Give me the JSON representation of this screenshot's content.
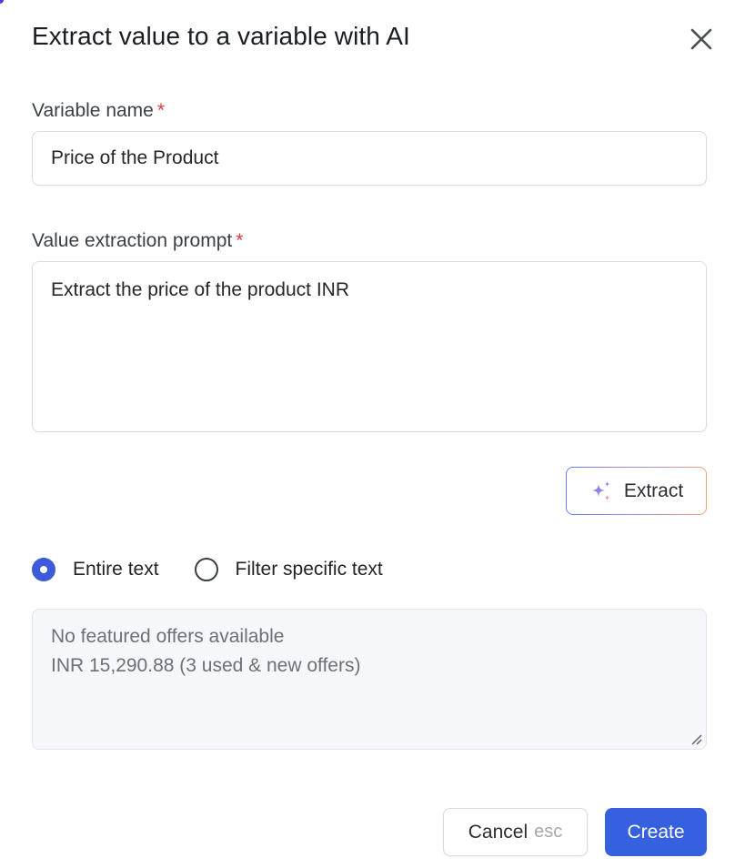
{
  "dialog": {
    "title": "Extract value to a variable with AI",
    "close_icon": "close-icon"
  },
  "variable_name": {
    "label": "Variable name",
    "required_marker": "*",
    "value": "Price of the Product"
  },
  "prompt": {
    "label": "Value extraction prompt",
    "required_marker": "*",
    "value": "Extract the price of the product INR"
  },
  "extract_button": {
    "label": "Extract",
    "icon": "sparkle-icon"
  },
  "text_mode": {
    "options": [
      {
        "label": "Entire text",
        "selected": true
      },
      {
        "label": "Filter specific text",
        "selected": false
      }
    ]
  },
  "preview": {
    "lines": [
      "No featured offers available",
      "INR 15,290.88 (3 used & new offers)"
    ]
  },
  "footer": {
    "cancel_label": "Cancel",
    "cancel_shortcut": "esc",
    "create_label": "Create"
  },
  "colors": {
    "primary": "#3560e0",
    "required": "#d63b3b",
    "radio_selected": "#3b5bdb"
  }
}
